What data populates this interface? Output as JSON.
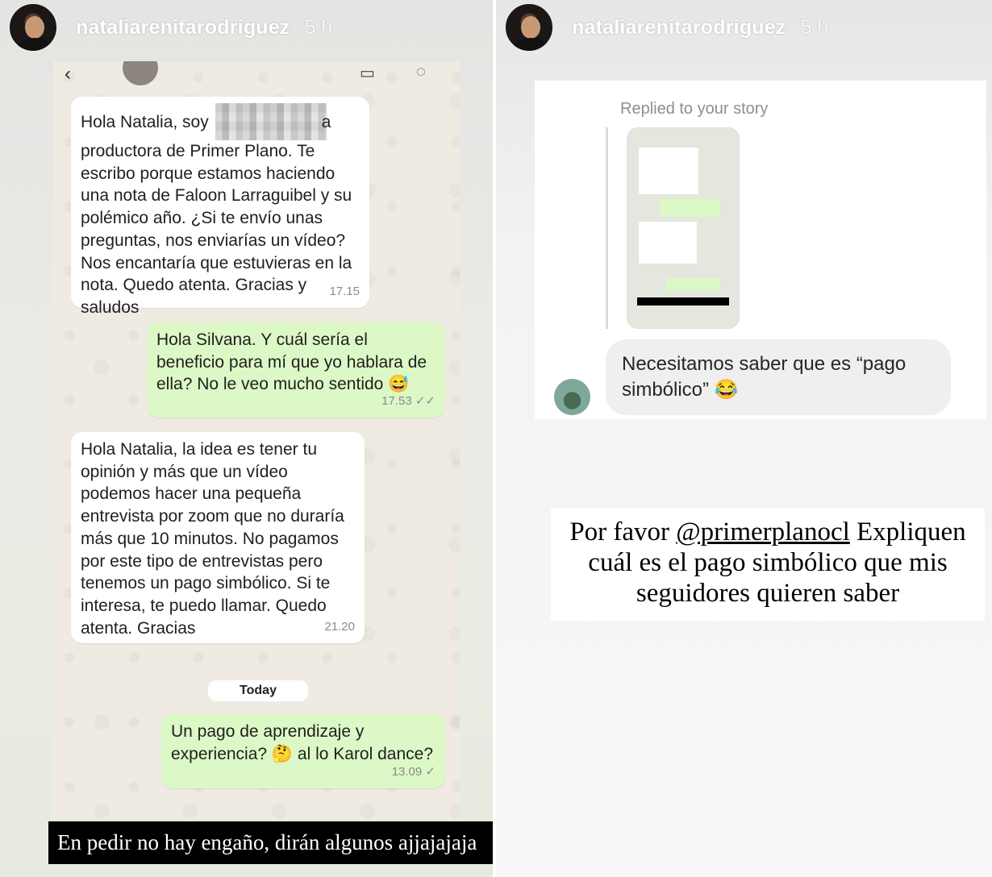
{
  "left_story": {
    "username": "nataliarenitarodriguez",
    "time": "5 h",
    "caption": "En pedir no hay engaño, dirán algunos ajjajajaja",
    "chat": {
      "messages": [
        {
          "dir": "in",
          "text_before": "Hola Natalia, soy ",
          "text_after": "a productora de Primer Plano. Te escribo porque estamos haciendo una nota de Faloon Larraguibel y su polémico año. ¿Si te envío unas preguntas, nos enviarías un vídeo? Nos encantaría que estuvieras en la nota. Quedo atenta. Gracias y saludos",
          "time": "17.15"
        },
        {
          "dir": "out",
          "text": "Hola Silvana. Y cuál sería el beneficio para mí que yo hablara de ella? No le veo mucho sentido 😅",
          "time": "17.53",
          "ticks": "✓✓"
        },
        {
          "dir": "in",
          "text": "Hola Natalia, la idea es tener tu opinión y más que un vídeo podemos hacer una pequeña entrevista por zoom que no duraría más que 10 minutos. No pagamos por este tipo de entrevistas pero tenemos un pago simbólico. Si te interesa, te puedo llamar. Quedo atenta. Gracias",
          "time": "21.20"
        },
        {
          "dir": "out",
          "text": "Un pago de aprendizaje y experiencia? 🤔 al lo Karol dance?",
          "time": "13.09",
          "ticks": "✓"
        }
      ],
      "day_separator": "Today"
    }
  },
  "right_story": {
    "username": "nataliarenitarodriguez",
    "time": "5 h",
    "replied_label": "Replied to your story",
    "message": "Necesitamos saber que es “pago simbólico” 😂",
    "caption_prefix": "Por favor ",
    "caption_mention": "@primerplanocl",
    "caption_suffix": "  Expliquen cuál es el pago simbólico que mis seguidores quieren saber"
  }
}
